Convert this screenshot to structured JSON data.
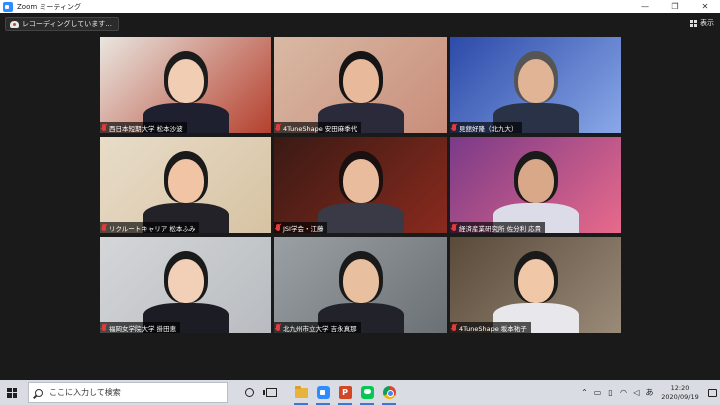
{
  "window": {
    "title": "Zoom ミーティング",
    "minimize": "—",
    "restore": "❐",
    "close": "✕"
  },
  "recording": {
    "label": "レコーディングしています..."
  },
  "view": {
    "label": "表示"
  },
  "participants": [
    {
      "name": "西日本短期大学 松本沙波",
      "bg": "#e9e6df",
      "accent": "#b5402e",
      "skin": "#f0cdb3",
      "hair": "#1c1c1c",
      "clothes": "#1e2030"
    },
    {
      "name": "4TuneShape 安田麻季代",
      "bg": "#d8b9a3",
      "accent": "#c98d7b",
      "skin": "#e8b99b",
      "hair": "#151515",
      "clothes": "#2a2a3a",
      "active": true
    },
    {
      "name": "見舘好隆（北九大）",
      "bg": "#2c4aa8",
      "accent": "#8aa8e8",
      "skin": "#e0b494",
      "hair": "#555555",
      "clothes": "#2a3248"
    },
    {
      "name": "リクルートキャリア 松本ふみ",
      "bg": "#e8dcc8",
      "accent": "#d7c3a3",
      "skin": "#f0c4a4",
      "hair": "#1a1a1a",
      "clothes": "#222228"
    },
    {
      "name": "JSI学会・江藤",
      "bg": "#3a1a14",
      "accent": "#8a2a1e",
      "skin": "#e8bc9c",
      "hair": "#1a1010",
      "clothes": "#3a3a46"
    },
    {
      "name": "経済産業研究所 佐分利 応貴",
      "bg": "#7a3a88",
      "accent": "#e86a8a",
      "skin": "#d8a888",
      "hair": "#1a1a1a",
      "clothes": "#dcdce8"
    },
    {
      "name": "福岡女学院大学 掛田恵",
      "bg": "#d4d6d8",
      "accent": "#b8bcc0",
      "skin": "#f2d0b8",
      "hair": "#1a1a1a",
      "clothes": "#1c1c24"
    },
    {
      "name": "北九州市立大学 吉永真那",
      "bg": "#9aa0a4",
      "accent": "#6a7074",
      "skin": "#e8c0a0",
      "hair": "#1a1a1a",
      "clothes": "#22222a"
    },
    {
      "name": "4TuneShape 坂本祐子",
      "bg": "#5a4a3a",
      "accent": "#9a8a78",
      "skin": "#f0c8a8",
      "hair": "#1a1a1a",
      "clothes": "#e8e8ec"
    }
  ],
  "taskbar": {
    "search_placeholder": "ここに入力して検索",
    "apps": [
      {
        "icon": "cortana-icon"
      },
      {
        "icon": "task-view-icon"
      },
      {
        "icon": "file-explorer-icon"
      },
      {
        "icon": "zoom-icon"
      },
      {
        "icon": "powerpoint-icon",
        "glyph": "P"
      },
      {
        "icon": "line-icon"
      },
      {
        "icon": "chrome-icon"
      }
    ],
    "tray": {
      "chevron": "⌃",
      "ime": "あ",
      "time": "12:20",
      "date": "2020/09/19"
    }
  }
}
